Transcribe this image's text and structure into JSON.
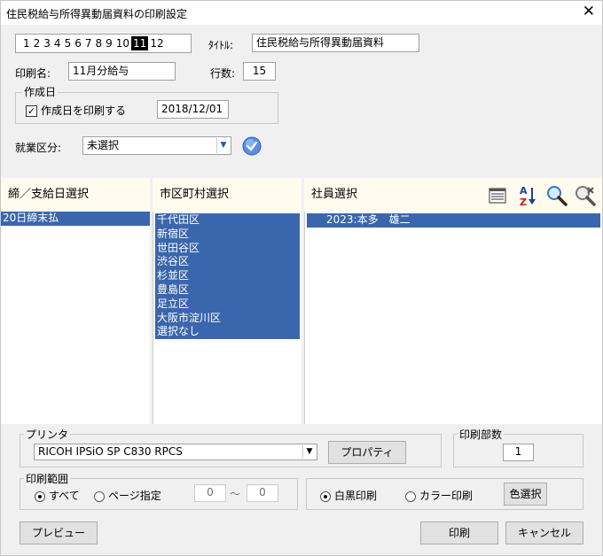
{
  "window": {
    "title": "住民税給与所得異動届資料の印刷設定",
    "close_symbol": "✕"
  },
  "tabs": {
    "items": [
      "1",
      "2",
      "3",
      "4",
      "5",
      "6",
      "7",
      "8",
      "9",
      "10",
      "11",
      "12"
    ],
    "active": "11"
  },
  "title_field": {
    "label": "ﾀｲﾄﾙ:",
    "value": "住民税給与所得異動届資料"
  },
  "print_name": {
    "label": "印刷名:",
    "value": "11月分給与"
  },
  "line_count": {
    "label": "行数:",
    "value": "15"
  },
  "creation_date": {
    "group_label": "作成日",
    "checkbox_label": "作成日を印刷する",
    "checked": true,
    "value": "2018/12/01"
  },
  "employment": {
    "label": "就業区分:",
    "value": "未選択"
  },
  "panels": {
    "closing": {
      "header": "締／支給日選択",
      "items": [
        "20日締末払"
      ]
    },
    "city": {
      "header": "市区町村選択",
      "items": [
        "千代田区",
        "新宿区",
        "世田谷区",
        "渋谷区",
        "杉並区",
        "豊島区",
        "足立区",
        "大阪市淀川区",
        "選択なし"
      ]
    },
    "employee": {
      "header": "社員選択",
      "items": [
        "2023:本多　雄二"
      ]
    }
  },
  "printer": {
    "group_label": "プリンタ",
    "value": "RICOH IPSiO SP C830 RPCS",
    "properties_label": "プロパティ"
  },
  "copies": {
    "group_label": "印刷部数",
    "value": "1"
  },
  "print_range": {
    "group_label": "印刷範囲",
    "all_label": "すべて",
    "page_label": "ページ指定",
    "from": "0",
    "tilde": "～",
    "to": "0"
  },
  "color": {
    "mono_label": "白黒印刷",
    "color_label": "カラー印刷",
    "select_color_label": "色選択"
  },
  "buttons": {
    "preview": "プレビュー",
    "print": "印刷",
    "cancel": "キャンセル"
  },
  "colors": {
    "selection": "#3a66ad",
    "panel_header": "#fffbee"
  },
  "icons": [
    "list-view-icon",
    "sort-az-icon",
    "search-icon",
    "clear-search-icon",
    "check-circle-icon"
  ]
}
